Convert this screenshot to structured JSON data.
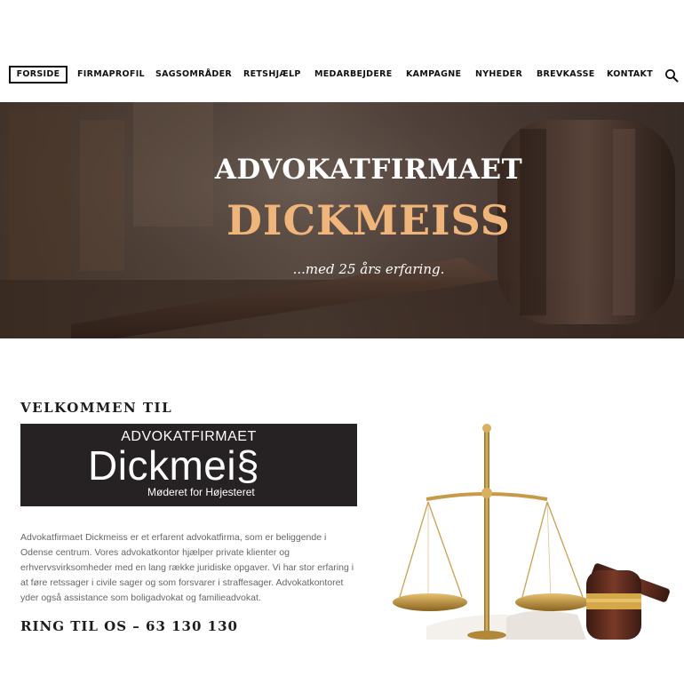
{
  "nav": {
    "items": [
      {
        "label": "FORSIDE",
        "active": true
      },
      {
        "label": "FIRMAPROFIL",
        "active": false
      },
      {
        "label": "SAGSOMRÅDER",
        "active": false
      },
      {
        "label": "RETSHJÆLP",
        "active": false
      },
      {
        "label": "MEDARBEJDERE",
        "active": false
      },
      {
        "label": "KAMPAGNE",
        "active": false
      },
      {
        "label": "NYHEDER",
        "active": false
      },
      {
        "label": "BREVKASSE",
        "active": false
      },
      {
        "label": "KONTAKT",
        "active": false
      }
    ],
    "search_icon": "search-icon"
  },
  "hero": {
    "title": "ADVOKATFIRMAET",
    "name": "DICKMEISS",
    "subtitle": "...med 25 års erfaring.",
    "image": "gavel-photo"
  },
  "intro": {
    "heading": "VELKOMMEN TIL",
    "logo": {
      "top": "ADVOKATFIRMAET",
      "main": "Dickmei§",
      "tagline": "Møderet for Højesteret"
    },
    "body": "Advokatfirmaet Dickmeiss er et erfarent advokatfirma, som er beliggende i Odense centrum. Vores advokatkontor hjælper private klienter og erhvervsvirksomheder med en lang række juridiske opgaver. Vi har stor erfaring i at føre retssager i civile sager og som forsvarer i straffesager. Advokatkontoret yder også assistance som boligadvokat og familieadvokat.",
    "call": "RING TIL OS – 63 130 130",
    "image": "scales-of-justice-photo"
  },
  "colors": {
    "accent": "#f0b57a",
    "logo_bg": "#262122",
    "text": "#1c1c1c"
  }
}
